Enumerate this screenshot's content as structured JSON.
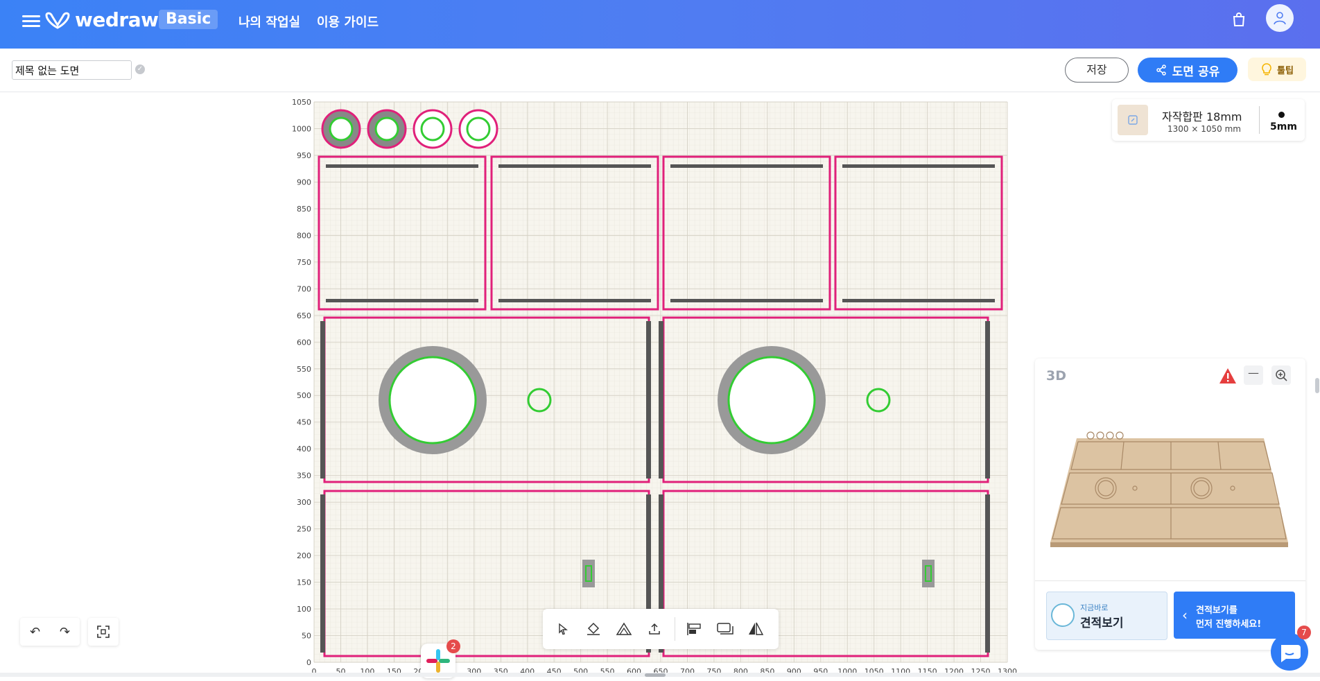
{
  "app": {
    "logo_text": "wedraw",
    "plan_badge": "Basic",
    "nav": [
      "나의 작업실",
      "이용 가이드"
    ]
  },
  "toolbar": {
    "title_value": "제목 없는 도면",
    "save_label": "저장",
    "share_label": "도면 공유",
    "tip_label": "툴팁"
  },
  "material": {
    "name": "자작합판 18mm",
    "size": "1300 × 1050 mm",
    "tool_size": "5mm"
  },
  "axes": {
    "y_ticks": [
      "1050",
      "1000",
      "950",
      "900",
      "850",
      "800",
      "750",
      "700",
      "650",
      "600",
      "550",
      "500",
      "450",
      "400",
      "350",
      "300",
      "250",
      "200",
      "150",
      "100",
      "50",
      "0"
    ],
    "x_ticks": [
      "0",
      "50",
      "100",
      "150",
      "200",
      "250",
      "300",
      "350",
      "400",
      "450",
      "500",
      "550",
      "600",
      "650",
      "700",
      "750",
      "800",
      "850",
      "900",
      "950",
      "1000",
      "1050",
      "1100",
      "1150",
      "1200",
      "1250",
      "1300"
    ]
  },
  "panel3d": {
    "title": "3D",
    "minimize_label": "—",
    "estimate_small": "지금바로",
    "estimate_big": "견적보기",
    "estimate_prompt_line1": "견적보기를",
    "estimate_prompt_line2": "먼저 진행하세요!"
  },
  "badges": {
    "slack_count": "2",
    "chat_count": "7"
  },
  "colors": {
    "header_blue": "#4f7df2",
    "cut_outline": "#e0207a",
    "green_circle": "#33cc33",
    "pocket_gray": "#999999",
    "warning_red": "#e53e3e"
  },
  "icons": [
    "menu-icon",
    "cart-icon",
    "user-icon",
    "check-icon",
    "share-icon",
    "lightbulb-icon",
    "edit-icon",
    "warning-icon",
    "zoom-in-icon",
    "undo-icon",
    "redo-icon",
    "fit-screen-icon",
    "select-tool-icon",
    "paint-tool-icon",
    "shape-tool-icon",
    "upload-icon",
    "align-icon",
    "layer-icon",
    "mirror-icon",
    "slack-icon",
    "chat-icon"
  ]
}
